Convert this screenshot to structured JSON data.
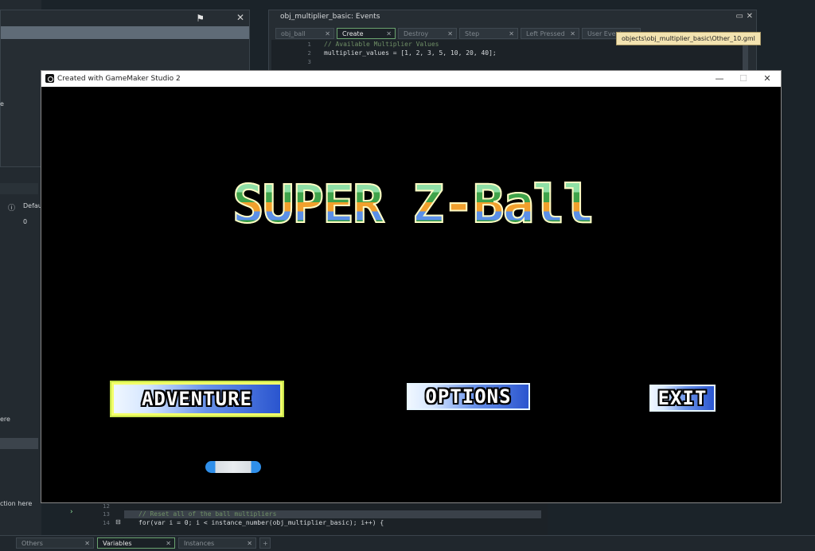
{
  "ide": {
    "events_window": {
      "title": "obj_multiplier_basic: Events",
      "tabs": [
        {
          "label": "obj_ball",
          "active": false
        },
        {
          "label": "Create",
          "active": true
        },
        {
          "label": "Destroy",
          "active": false
        },
        {
          "label": "Step",
          "active": false
        },
        {
          "label": "Left Pressed",
          "active": false
        },
        {
          "label": "User Event",
          "active": false
        }
      ],
      "tooltip": "objects\\obj_multiplier_basic\\Other_10.gml",
      "code_lines": [
        {
          "num": "1",
          "text": "// Available Multiplier Values"
        },
        {
          "num": "2",
          "text": "multiplier_values = [1, 2, 3, 5, 10, 20, 40];"
        },
        {
          "num": "3",
          "text": ""
        }
      ]
    },
    "left_panel": {
      "column_header": "Defau",
      "value": "0",
      "fragments": [
        "e",
        "ere",
        "ction here"
      ]
    },
    "bottom_code": [
      {
        "num": "12",
        "text": ""
      },
      {
        "num": "13",
        "text": "// Reset all of the ball multipliers"
      },
      {
        "num": "14",
        "text": "for(var i = 0; i < instance_number(obj_multiplier_basic); i++) {"
      }
    ],
    "bottom_tabs": [
      {
        "label": "Others",
        "active": false
      },
      {
        "label": "Variables",
        "active": true
      },
      {
        "label": "Instances",
        "active": false
      }
    ],
    "add_tab": "+"
  },
  "game_window": {
    "title": "Created with GameMaker Studio 2",
    "controls": {
      "minimize": "—",
      "maximize": "☐",
      "close": "✕"
    },
    "logo_text": "SUPER Z-Ball",
    "menu": [
      {
        "label": "ADVENTURE",
        "selected": true
      },
      {
        "label": "OPTIONS",
        "selected": false
      },
      {
        "label": "EXIT",
        "selected": false
      }
    ]
  },
  "colors": {
    "accent_green": "#6aa36f",
    "button_blue": "#2a55cf",
    "selection_yellow": "#f3ff6a"
  }
}
